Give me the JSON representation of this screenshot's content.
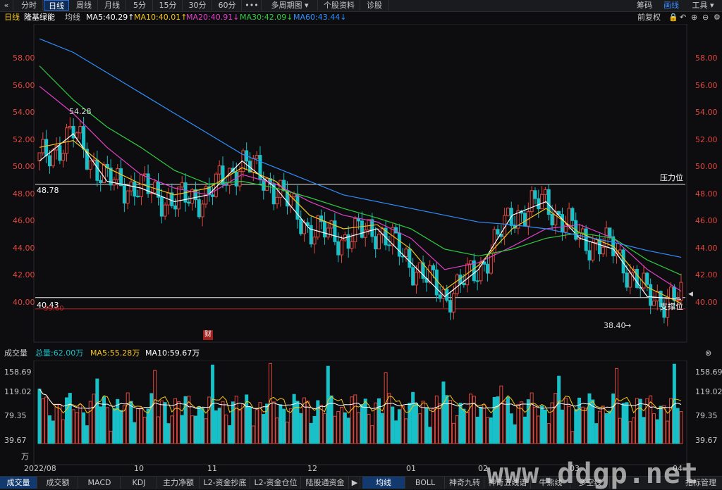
{
  "toolbar": {
    "back_icon": "chevron-left-icon",
    "tabs": [
      "分时",
      "日线",
      "周线",
      "月线",
      "5分",
      "15分",
      "30分",
      "60分",
      "•••",
      "多周期图 ▾",
      "个股资料",
      "诊股"
    ],
    "active_tab": "日线",
    "right_items": [
      "筹码",
      "画线",
      "工具 ▾"
    ]
  },
  "info": {
    "period": "日线",
    "name": "隆基绿能",
    "ma_label": "均线",
    "ma5": "MA5:40.29↑",
    "ma10": "MA10:40.01↑",
    "ma20": "MA20:40.91↓",
    "ma30": "MA30:42.09↓",
    "ma60": "MA60:43.44↓",
    "fq": "前复权",
    "colors": {
      "ma5": "#ffffff",
      "ma10": "#f5c518",
      "ma20": "#e040c8",
      "ma30": "#2ecc40",
      "ma60": "#2f8fff"
    }
  },
  "price_axis": {
    "ticks_left": [
      "58.00",
      "56.00",
      "54.00",
      "52.00",
      "50.00",
      "48.00",
      "46.00",
      "44.00",
      "42.00",
      "40.00"
    ],
    "ticks_right": [
      "58.00",
      "56.00",
      "54.00",
      "52.00",
      "50.00",
      "48.00",
      "46.00",
      "44.00",
      "42.00",
      "40.00"
    ],
    "range": [
      38.4,
      58.0
    ]
  },
  "annotations": {
    "high_label": "54.28",
    "low_label": "38.40",
    "resistance_value": "48.78",
    "resistance_text": "压力位",
    "support_value": "40.43",
    "support_text": "支撑位",
    "support_sub": "39.60",
    "finance_badge": "财"
  },
  "volume_info": {
    "title": "成交量",
    "total": "总量:62.00万",
    "ma5": "MA5:55.28万",
    "ma10": "MA10:59.67万",
    "ticks": [
      "158.69",
      "119.02",
      "79.35",
      "39.67",
      "万"
    ]
  },
  "x_axis": {
    "labels": [
      "2022/08",
      "10",
      "11",
      "12",
      "01",
      "02",
      "03",
      "04"
    ]
  },
  "bottom_tabs": [
    "成交量",
    "成交额",
    "MACD",
    "KDJ",
    "主力净额",
    "L2-资金抄底",
    "L2-资金仓位",
    "陆股通资金",
    "▶",
    "均线",
    "BOLL",
    "神奇九转",
    "神奇五线谱",
    "牛熊线",
    "多空线",
    "指标管理"
  ],
  "bottom_active": [
    "成交量",
    "均线"
  ],
  "watermark": "www.ddgp.net",
  "chart_data": {
    "type": "candlestick",
    "title": "隆基绿能",
    "x": [
      "2022/08",
      "10",
      "11",
      "12",
      "01",
      "02",
      "03",
      "04"
    ],
    "ylim": [
      38.4,
      58.0
    ],
    "series": [
      {
        "name": "MA5",
        "values": [
          50.5,
          52.5,
          49.0,
          48.5,
          47.5,
          48.0,
          50.5,
          48.5,
          45.5,
          44.8,
          45.5,
          43.0,
          40.5,
          42.5,
          46.5,
          47.5,
          44.8,
          44.0,
          40.5,
          40.3
        ]
      },
      {
        "name": "MA10",
        "values": [
          51.5,
          52.0,
          50.0,
          48.8,
          48.0,
          48.5,
          50.0,
          49.0,
          46.5,
          45.5,
          45.8,
          44.0,
          41.0,
          42.8,
          45.5,
          47.0,
          45.2,
          44.2,
          41.2,
          40.0
        ]
      },
      {
        "name": "MA20",
        "values": [
          56.0,
          54.0,
          51.5,
          49.5,
          48.5,
          48.0,
          49.5,
          48.8,
          47.5,
          46.5,
          46.0,
          44.8,
          42.5,
          43.0,
          44.2,
          45.5,
          45.8,
          44.8,
          42.5,
          40.9
        ]
      },
      {
        "name": "MA30",
        "values": [
          57.5,
          55.0,
          53.0,
          51.5,
          49.8,
          48.8,
          49.0,
          48.5,
          47.8,
          47.0,
          46.3,
          45.5,
          44.0,
          43.5,
          44.0,
          44.8,
          45.2,
          44.8,
          43.2,
          42.1
        ]
      },
      {
        "name": "MA60",
        "values": [
          59.5,
          58.5,
          57.0,
          55.5,
          54.0,
          52.5,
          51.0,
          50.0,
          49.0,
          48.0,
          47.5,
          47.0,
          46.5,
          46.0,
          45.8,
          45.5,
          45.0,
          44.5,
          43.9,
          43.4
        ]
      }
    ],
    "hlines": [
      48.78,
      40.43,
      39.6
    ]
  }
}
